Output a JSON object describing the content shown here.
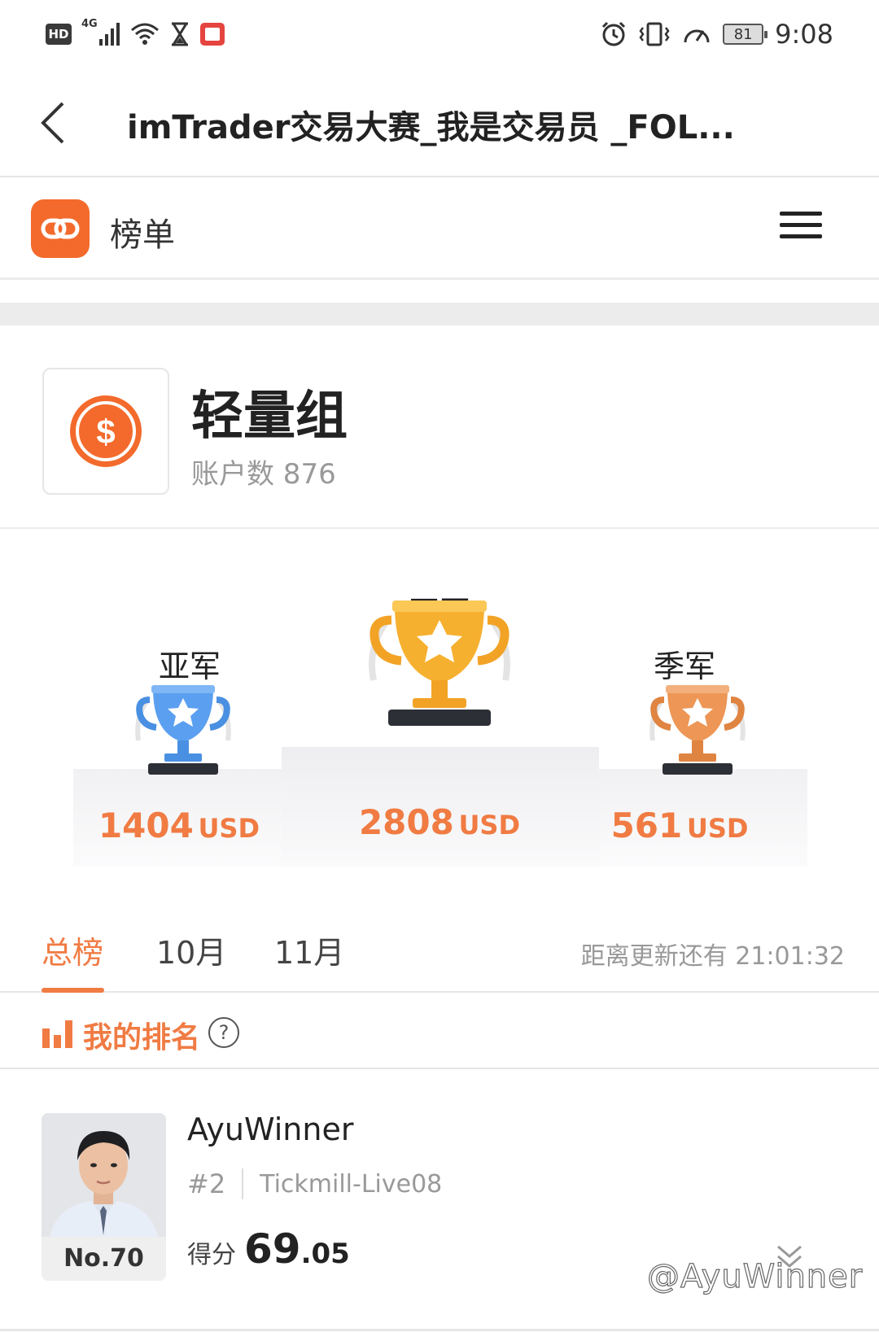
{
  "status_bar": {
    "hd_label": "HD",
    "network_label": "4G",
    "battery_level": "81",
    "time": "9:08",
    "icons": [
      "hd-icon",
      "signal-icon",
      "wifi-icon",
      "hourglass-icon",
      "book-icon",
      "alarm-icon",
      "vibrate-icon",
      "speedometer-icon",
      "battery-icon"
    ]
  },
  "nav": {
    "title": "imTrader交易大赛_我是交易员 _FOL..."
  },
  "app_header": {
    "label": "榜单"
  },
  "group": {
    "title": "轻量组",
    "account_count_text": "账户数 876"
  },
  "podium": {
    "first": {
      "label": "冠军",
      "amount": "2808",
      "unit": "USD"
    },
    "second": {
      "label": "亚军",
      "amount": "1404",
      "unit": "USD"
    },
    "third": {
      "label": "季军",
      "amount": "561",
      "unit": "USD"
    }
  },
  "tabs": {
    "items": [
      {
        "label": "总榜",
        "active": true
      },
      {
        "label": "10月",
        "active": false
      },
      {
        "label": "11月",
        "active": false
      }
    ],
    "countdown": "距离更新还有 21:01:32"
  },
  "my_ranking": {
    "label": "我的排名",
    "help_symbol": "?"
  },
  "user": {
    "name": "AyuWinner",
    "group_rank": "#2",
    "broker": "Tickmill-Live08",
    "position": "No.70",
    "score_label": "得分",
    "score_int": "69",
    "score_dec": ".05"
  },
  "watermark": "@AyuWinner",
  "colors": {
    "accent": "#f07b43",
    "brand": "#f36a2c",
    "gold": "#f5a623",
    "silver_blue": "#4a90e2",
    "bronze": "#e8904c"
  }
}
